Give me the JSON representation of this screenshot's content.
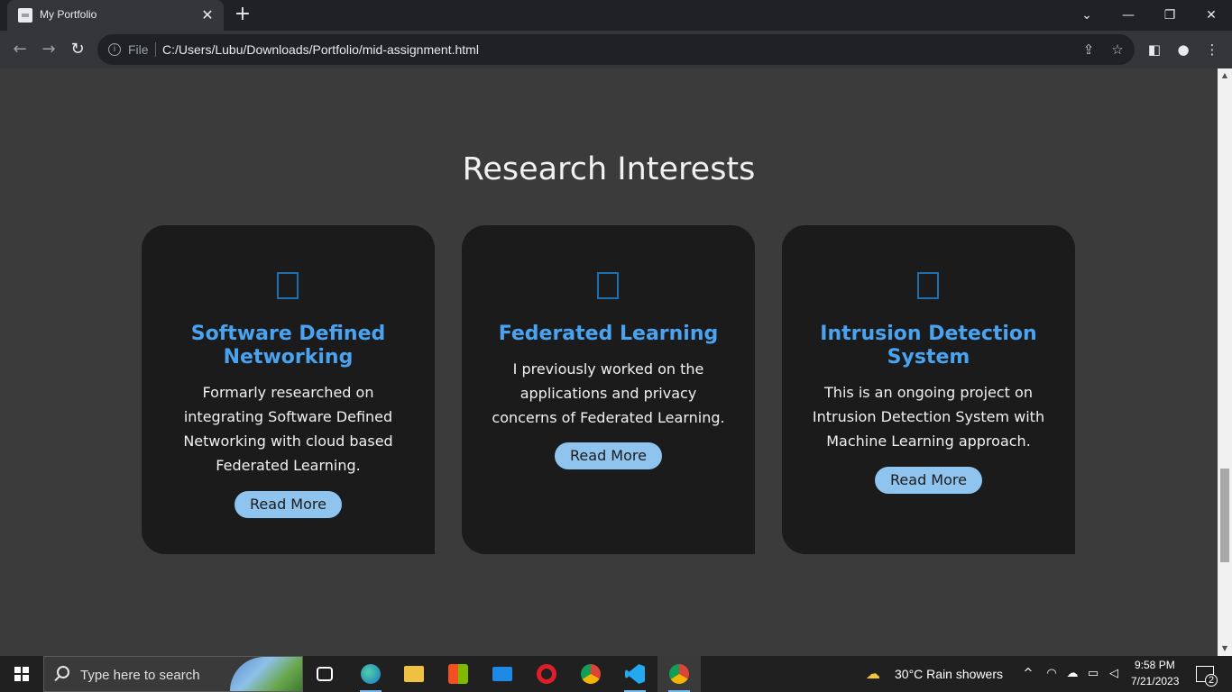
{
  "browser": {
    "tab_title": "My Portfolio",
    "scheme_label": "File",
    "url": "C:/Users/Lubu/Downloads/Portfolio/mid-assignment.html"
  },
  "page": {
    "section_title": "Research Interests",
    "cards": [
      {
        "title": "Software Defined Networking",
        "text": "Formarly researched on integrating Software Defined Networking with cloud based Federated Learning.",
        "button": "Read More"
      },
      {
        "title": "Federated Learning",
        "text": "I previously worked on the applications and privacy concerns of Federated Learning.",
        "button": "Read More"
      },
      {
        "title": "Intrusion Detection System",
        "text": "This is an ongoing project on Intrusion Detection System with Machine Learning approach.",
        "button": "Read More"
      }
    ]
  },
  "taskbar": {
    "search_placeholder": "Type here to search",
    "weather": "30°C  Rain showers",
    "time": "9:58 PM",
    "date": "7/21/2023",
    "notification_count": "2"
  },
  "colors": {
    "page_bg": "#3a3b3a",
    "card_bg": "#1b1b1b",
    "accent": "#4aa3f0",
    "button_bg": "#8fc4ee"
  }
}
